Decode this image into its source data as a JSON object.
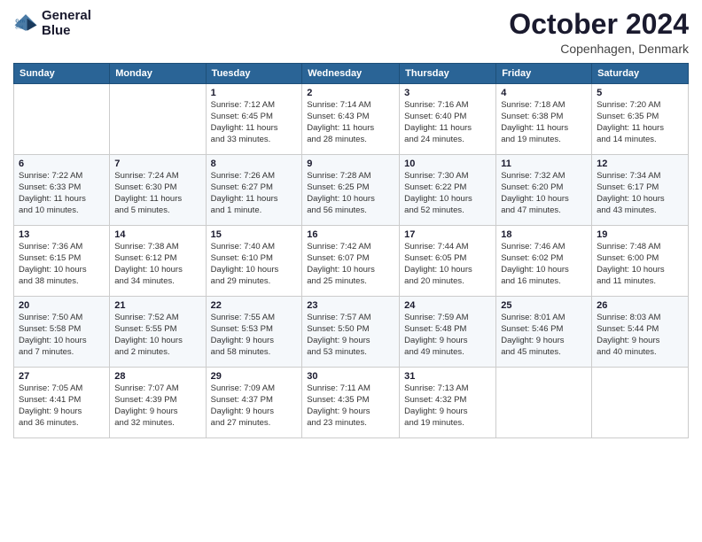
{
  "header": {
    "logo_line1": "General",
    "logo_line2": "Blue",
    "month_title": "October 2024",
    "location": "Copenhagen, Denmark"
  },
  "days_of_week": [
    "Sunday",
    "Monday",
    "Tuesday",
    "Wednesday",
    "Thursday",
    "Friday",
    "Saturday"
  ],
  "weeks": [
    [
      {
        "day": "",
        "info": ""
      },
      {
        "day": "",
        "info": ""
      },
      {
        "day": "1",
        "info": "Sunrise: 7:12 AM\nSunset: 6:45 PM\nDaylight: 11 hours\nand 33 minutes."
      },
      {
        "day": "2",
        "info": "Sunrise: 7:14 AM\nSunset: 6:43 PM\nDaylight: 11 hours\nand 28 minutes."
      },
      {
        "day": "3",
        "info": "Sunrise: 7:16 AM\nSunset: 6:40 PM\nDaylight: 11 hours\nand 24 minutes."
      },
      {
        "day": "4",
        "info": "Sunrise: 7:18 AM\nSunset: 6:38 PM\nDaylight: 11 hours\nand 19 minutes."
      },
      {
        "day": "5",
        "info": "Sunrise: 7:20 AM\nSunset: 6:35 PM\nDaylight: 11 hours\nand 14 minutes."
      }
    ],
    [
      {
        "day": "6",
        "info": "Sunrise: 7:22 AM\nSunset: 6:33 PM\nDaylight: 11 hours\nand 10 minutes."
      },
      {
        "day": "7",
        "info": "Sunrise: 7:24 AM\nSunset: 6:30 PM\nDaylight: 11 hours\nand 5 minutes."
      },
      {
        "day": "8",
        "info": "Sunrise: 7:26 AM\nSunset: 6:27 PM\nDaylight: 11 hours\nand 1 minute."
      },
      {
        "day": "9",
        "info": "Sunrise: 7:28 AM\nSunset: 6:25 PM\nDaylight: 10 hours\nand 56 minutes."
      },
      {
        "day": "10",
        "info": "Sunrise: 7:30 AM\nSunset: 6:22 PM\nDaylight: 10 hours\nand 52 minutes."
      },
      {
        "day": "11",
        "info": "Sunrise: 7:32 AM\nSunset: 6:20 PM\nDaylight: 10 hours\nand 47 minutes."
      },
      {
        "day": "12",
        "info": "Sunrise: 7:34 AM\nSunset: 6:17 PM\nDaylight: 10 hours\nand 43 minutes."
      }
    ],
    [
      {
        "day": "13",
        "info": "Sunrise: 7:36 AM\nSunset: 6:15 PM\nDaylight: 10 hours\nand 38 minutes."
      },
      {
        "day": "14",
        "info": "Sunrise: 7:38 AM\nSunset: 6:12 PM\nDaylight: 10 hours\nand 34 minutes."
      },
      {
        "day": "15",
        "info": "Sunrise: 7:40 AM\nSunset: 6:10 PM\nDaylight: 10 hours\nand 29 minutes."
      },
      {
        "day": "16",
        "info": "Sunrise: 7:42 AM\nSunset: 6:07 PM\nDaylight: 10 hours\nand 25 minutes."
      },
      {
        "day": "17",
        "info": "Sunrise: 7:44 AM\nSunset: 6:05 PM\nDaylight: 10 hours\nand 20 minutes."
      },
      {
        "day": "18",
        "info": "Sunrise: 7:46 AM\nSunset: 6:02 PM\nDaylight: 10 hours\nand 16 minutes."
      },
      {
        "day": "19",
        "info": "Sunrise: 7:48 AM\nSunset: 6:00 PM\nDaylight: 10 hours\nand 11 minutes."
      }
    ],
    [
      {
        "day": "20",
        "info": "Sunrise: 7:50 AM\nSunset: 5:58 PM\nDaylight: 10 hours\nand 7 minutes."
      },
      {
        "day": "21",
        "info": "Sunrise: 7:52 AM\nSunset: 5:55 PM\nDaylight: 10 hours\nand 2 minutes."
      },
      {
        "day": "22",
        "info": "Sunrise: 7:55 AM\nSunset: 5:53 PM\nDaylight: 9 hours\nand 58 minutes."
      },
      {
        "day": "23",
        "info": "Sunrise: 7:57 AM\nSunset: 5:50 PM\nDaylight: 9 hours\nand 53 minutes."
      },
      {
        "day": "24",
        "info": "Sunrise: 7:59 AM\nSunset: 5:48 PM\nDaylight: 9 hours\nand 49 minutes."
      },
      {
        "day": "25",
        "info": "Sunrise: 8:01 AM\nSunset: 5:46 PM\nDaylight: 9 hours\nand 45 minutes."
      },
      {
        "day": "26",
        "info": "Sunrise: 8:03 AM\nSunset: 5:44 PM\nDaylight: 9 hours\nand 40 minutes."
      }
    ],
    [
      {
        "day": "27",
        "info": "Sunrise: 7:05 AM\nSunset: 4:41 PM\nDaylight: 9 hours\nand 36 minutes."
      },
      {
        "day": "28",
        "info": "Sunrise: 7:07 AM\nSunset: 4:39 PM\nDaylight: 9 hours\nand 32 minutes."
      },
      {
        "day": "29",
        "info": "Sunrise: 7:09 AM\nSunset: 4:37 PM\nDaylight: 9 hours\nand 27 minutes."
      },
      {
        "day": "30",
        "info": "Sunrise: 7:11 AM\nSunset: 4:35 PM\nDaylight: 9 hours\nand 23 minutes."
      },
      {
        "day": "31",
        "info": "Sunrise: 7:13 AM\nSunset: 4:32 PM\nDaylight: 9 hours\nand 19 minutes."
      },
      {
        "day": "",
        "info": ""
      },
      {
        "day": "",
        "info": ""
      }
    ]
  ]
}
